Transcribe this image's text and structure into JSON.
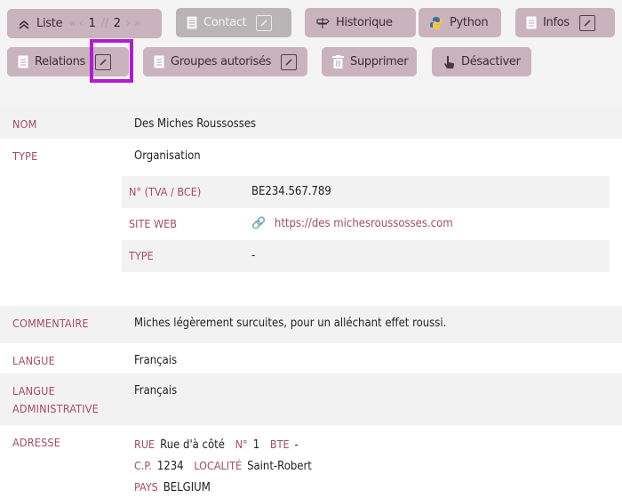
{
  "toolbar": {
    "liste": "Liste",
    "pager_current": "1",
    "pager_sep": "//",
    "pager_total": "2",
    "pager_prev": "« ‹",
    "pager_next": "› »",
    "contact": "Contact",
    "historique": "Historique",
    "python": "Python",
    "infos": "Infos",
    "relations": "Relations",
    "groupes": "Groupes autorisés",
    "supprimer": "Supprimer",
    "desactiver": "Désactiver"
  },
  "fields": {
    "nom_label": "NOM",
    "nom_value": "Des Miches Roussosses",
    "type_label": "TYPE",
    "type_value": "Organisation",
    "tva_label": "N° (TVA / BCE)",
    "tva_value": "BE234.567.789",
    "site_label": "SITE WEB",
    "site_value": "https://des michesroussosses.com",
    "subtype_label": "TYPE",
    "subtype_value": "-",
    "commentaire_label": "COMMENTAIRE",
    "commentaire_value": "Miches légèrement surcuites, pour un alléchant effet roussi.",
    "langue_label": "LANGUE",
    "langue_value": "Français",
    "langue_admin_label": "LANGUE ADMINISTRATIVE",
    "langue_admin_value": "Français",
    "adresse_label": "ADRESSE"
  },
  "address": {
    "rue_k": "RUE",
    "rue_v": "Rue d'à côté",
    "num_k": "N°",
    "num_v": "1",
    "bte_k": "BTE",
    "bte_v": "-",
    "cp_k": "C.P.",
    "cp_v": "1234",
    "loc_k": "LOCALITÉ",
    "loc_v": "Saint-Robert",
    "pays_k": "PAYS",
    "pays_v": "BELGIUM"
  },
  "colors": {
    "accent": "#a54b6b",
    "button": "#c9b3bd",
    "highlight": "#b21bd6"
  }
}
